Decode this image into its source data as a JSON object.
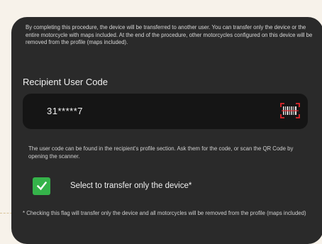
{
  "intro_text": "By completing this procedure, the device will be transferred to another user. You can transfer only the device or the entire motorcycle with maps included. At the end of the procedure, other motorcycles configured on this device will be removed from the profile (maps included).",
  "recipient": {
    "title": "Recipient User Code",
    "code_value": "31*****7",
    "scanner_icon": "qr-scanner-icon",
    "hint": "The user code can be found in the recipient's profile section. Ask them for the code, or scan the QR Code by opening the scanner."
  },
  "transfer_option": {
    "checked": true,
    "label": "Select to transfer only the device*"
  },
  "footnote": "* Checking this flag will transfer only the device and all motorcycles will be removed from the profile (maps included)",
  "colors": {
    "background": "#2a2a2a",
    "input_background": "#151515",
    "checkbox_green": "#35b34a",
    "scanner_red": "#e0262b"
  }
}
